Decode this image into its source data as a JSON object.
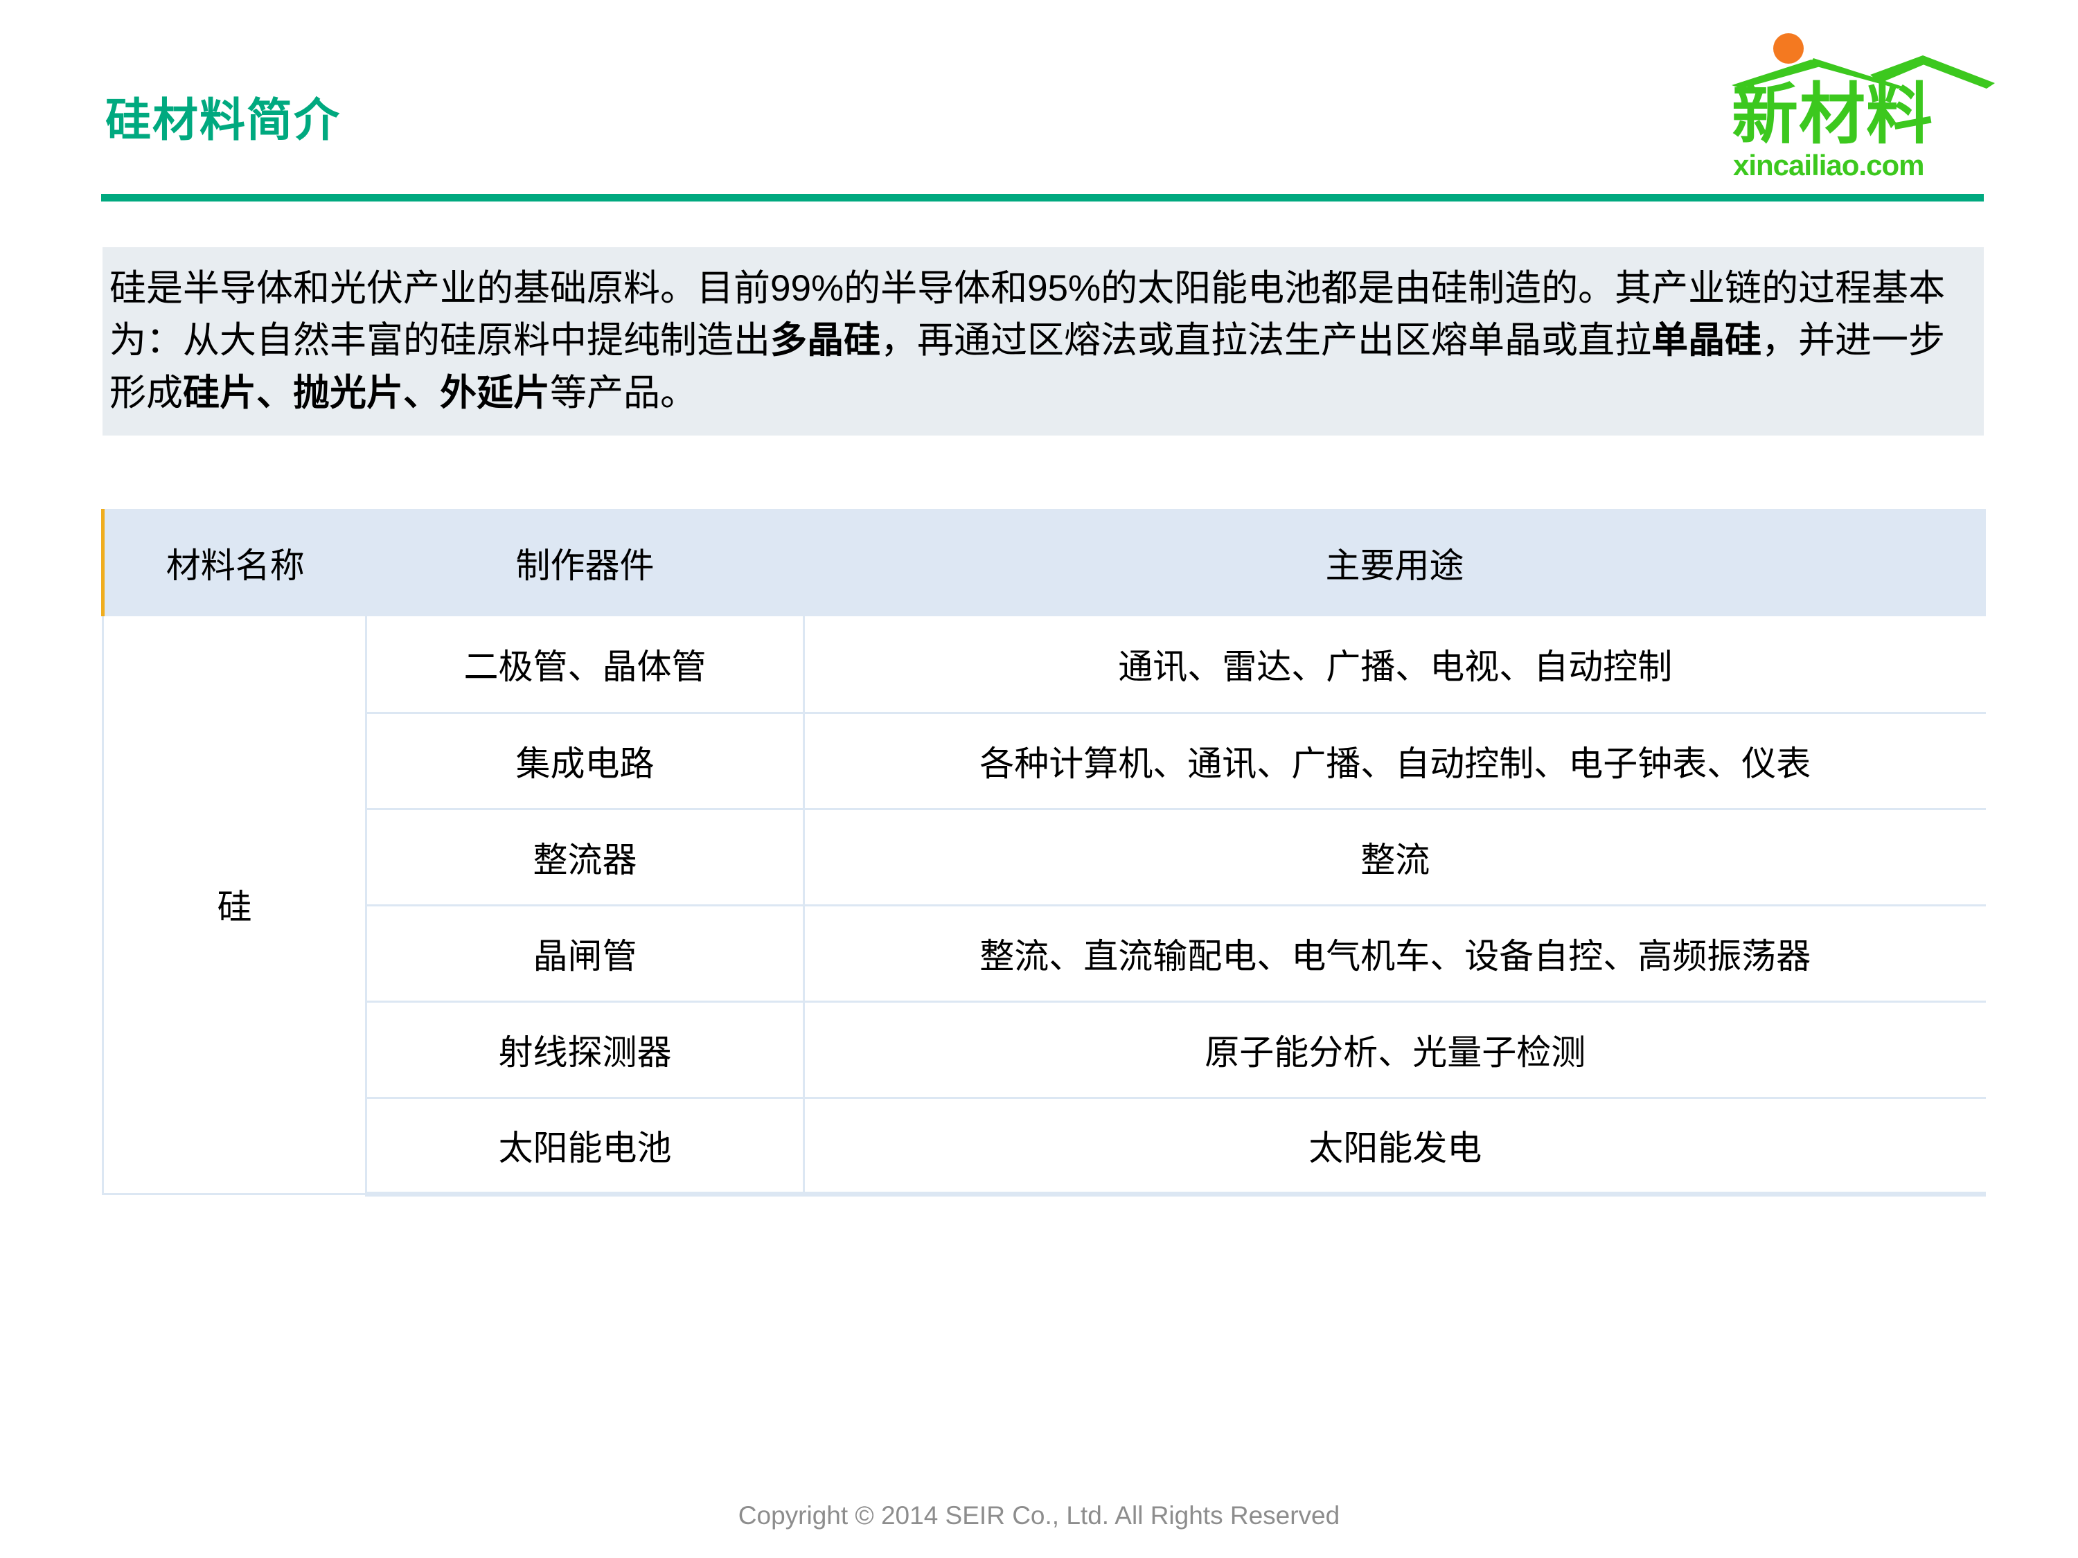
{
  "header": {
    "title": "硅材料简介",
    "accent_color": "#00a97f"
  },
  "logo": {
    "wordmark": "新材料",
    "domain": "xincailiao.com",
    "green": "#3cc81e",
    "sun_color": "#f47920",
    "sun_icon": "sun-circle-icon",
    "roof_icon": "mountain-roof-icon"
  },
  "intro": {
    "segments": [
      {
        "text": "硅是半导体和光伏产业的基础原料。目前99%的半导体和95%的太阳能电池都是由硅制造的。其产业链的过程基本为：从大自然丰富的硅原料中提纯制造出",
        "bold": false
      },
      {
        "text": "多晶硅",
        "bold": true
      },
      {
        "text": "，再通过区熔法或直拉法生产出区熔单晶或直拉",
        "bold": false
      },
      {
        "text": "单晶硅",
        "bold": true
      },
      {
        "text": "，并进一步形成",
        "bold": false
      },
      {
        "text": "硅片、抛光片、外延片",
        "bold": true
      },
      {
        "text": "等产品。",
        "bold": false
      }
    ],
    "background": "#e8edf1"
  },
  "table": {
    "header_background": "#dde7f3",
    "border_color": "#dce7f3",
    "accent_bar_color": "#f0ad1e",
    "columns": [
      "材料名称",
      "制作器件",
      "主要用途"
    ],
    "material": "硅",
    "rows": [
      {
        "device": "二极管、晶体管",
        "use": "通讯、雷达、广播、电视、自动控制"
      },
      {
        "device": "集成电路",
        "use": "各种计算机、通讯、广播、自动控制、电子钟表、仪表"
      },
      {
        "device": "整流器",
        "use": "整流"
      },
      {
        "device": "晶闸管",
        "use": "整流、直流输配电、电气机车、设备自控、高频振荡器"
      },
      {
        "device": "射线探测器",
        "use": "原子能分析、光量子检测"
      },
      {
        "device": "太阳能电池",
        "use": "太阳能发电"
      }
    ]
  },
  "footer": {
    "copyright": "Copyright © 2014  SEIR Co., Ltd. All Rights Reserved"
  }
}
